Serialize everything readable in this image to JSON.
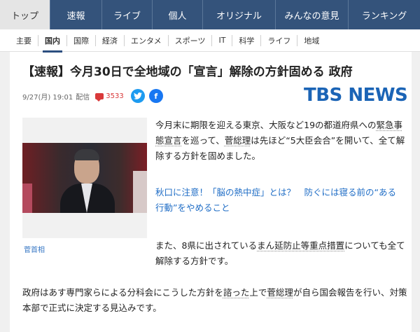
{
  "top_nav": {
    "tabs": [
      {
        "label": "トップ",
        "active": true
      },
      {
        "label": "速報",
        "active": false
      },
      {
        "label": "ライブ",
        "active": false
      },
      {
        "label": "個人",
        "active": false
      },
      {
        "label": "オリジナル",
        "active": false
      },
      {
        "label": "みんなの意見",
        "active": false
      },
      {
        "label": "ランキング",
        "active": false
      }
    ]
  },
  "category_nav": {
    "items": [
      {
        "label": "主要",
        "active": false
      },
      {
        "label": "国内",
        "active": true
      },
      {
        "label": "国際",
        "active": false
      },
      {
        "label": "経済",
        "active": false
      },
      {
        "label": "エンタメ",
        "active": false
      },
      {
        "label": "スポーツ",
        "active": false
      },
      {
        "label": "IT",
        "active": false
      },
      {
        "label": "科学",
        "active": false
      },
      {
        "label": "ライフ",
        "active": false
      },
      {
        "label": "地域",
        "active": false
      }
    ]
  },
  "article": {
    "headline": "【速報】今月30日で全地域の「宣言」解除の方針固める 政府",
    "date": "9/27(月) 19:01",
    "delivery_label": "配信",
    "comment_count": "3533",
    "source_logo": "TBS NEWS",
    "photo_caption": "菅首相",
    "paragraph1_a": "今月末に期限を迎える東京、大阪など19の都道府県への",
    "paragraph1_b": "緊急事態宣言",
    "paragraph1_c": "を巡って、",
    "paragraph1_d": "菅総理",
    "paragraph1_e": "は先ほど“5大臣会合”を開いて、全て解除する方針を固めました。",
    "related_link": "秋口に注意！「脳の熱中症」とは？　防ぐには寝る前の“ある行動”をやめること",
    "paragraph2_a": "また、8県に出されている",
    "paragraph2_b": "まん延防止等重点措置",
    "paragraph2_c": "についても全て解除する方針です。",
    "paragraph3_a": "政府はあす専門家らによる分科会にこうした方針を",
    "paragraph3_b": "諮った",
    "paragraph3_c": "上で",
    "paragraph3_d": "菅総理",
    "paragraph3_e": "が自ら国会報告を行い、対策本部で正式に決定する見込みです。"
  },
  "colors": {
    "nav_bg": "#34537b",
    "brand_blue": "#1b64b6",
    "comment_red": "#d9393a",
    "link_blue": "#1f6dc6"
  },
  "icons": {
    "comment": "comment-icon",
    "twitter": "twitter-icon",
    "facebook": "facebook-icon"
  }
}
